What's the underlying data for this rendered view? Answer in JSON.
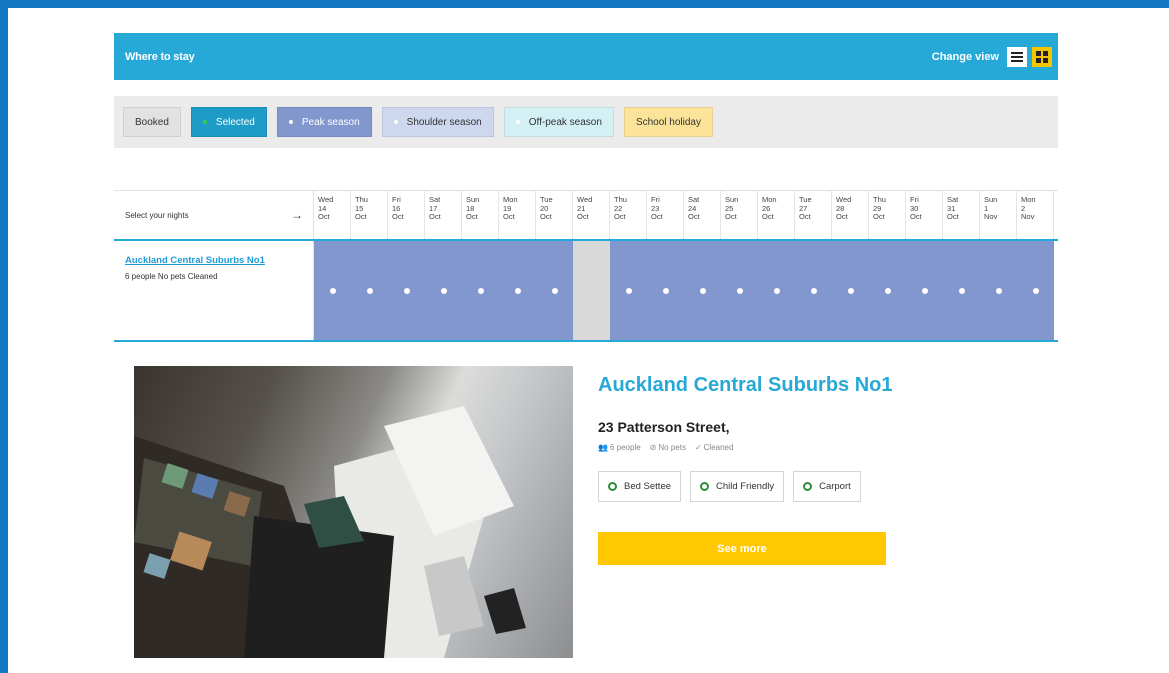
{
  "header": {
    "title": "Where to stay",
    "change_view_label": "Change view",
    "list_view_icon": "list-icon",
    "grid_view_icon": "grid-icon",
    "accent_color": "#27a9d8"
  },
  "legend": [
    {
      "label": "Booked",
      "bg": "#e2e2e2",
      "fg": "#333333",
      "dot": null
    },
    {
      "label": "Selected",
      "bg": "#1e9bc7",
      "fg": "#ffffff",
      "dot": "#2fd14a"
    },
    {
      "label": "Peak season",
      "bg": "#8397cf",
      "fg": "#ffffff",
      "dot": "#ffffff"
    },
    {
      "label": "Shoulder season",
      "bg": "#cdd8ef",
      "fg": "#333333",
      "dot": "#ffffff"
    },
    {
      "label": "Off-peak season",
      "bg": "#d3f0f5",
      "fg": "#333333",
      "dot": "#ffffff"
    },
    {
      "label": "School holiday",
      "bg": "#fce39a",
      "fg": "#333333",
      "dot": null
    }
  ],
  "calendar": {
    "select_label": "Select your nights",
    "days": [
      {
        "dow": "Wed",
        "d": "14",
        "m": "Oct"
      },
      {
        "dow": "Thu",
        "d": "15",
        "m": "Oct"
      },
      {
        "dow": "Fri",
        "d": "16",
        "m": "Oct"
      },
      {
        "dow": "Sat",
        "d": "17",
        "m": "Oct"
      },
      {
        "dow": "Sun",
        "d": "18",
        "m": "Oct"
      },
      {
        "dow": "Mon",
        "d": "19",
        "m": "Oct"
      },
      {
        "dow": "Tue",
        "d": "20",
        "m": "Oct"
      },
      {
        "dow": "Wed",
        "d": "21",
        "m": "Oct"
      },
      {
        "dow": "Thu",
        "d": "22",
        "m": "Oct"
      },
      {
        "dow": "Fri",
        "d": "23",
        "m": "Oct"
      },
      {
        "dow": "Sat",
        "d": "24",
        "m": "Oct"
      },
      {
        "dow": "Sun",
        "d": "25",
        "m": "Oct"
      },
      {
        "dow": "Mon",
        "d": "26",
        "m": "Oct"
      },
      {
        "dow": "Tue",
        "d": "27",
        "m": "Oct"
      },
      {
        "dow": "Wed",
        "d": "28",
        "m": "Oct"
      },
      {
        "dow": "Thu",
        "d": "29",
        "m": "Oct"
      },
      {
        "dow": "Fri",
        "d": "30",
        "m": "Oct"
      },
      {
        "dow": "Sat",
        "d": "31",
        "m": "Oct"
      },
      {
        "dow": "Sun",
        "d": "1",
        "m": "Nov"
      },
      {
        "dow": "Mon",
        "d": "2",
        "m": "Nov"
      }
    ],
    "night_status": [
      "peak",
      "peak",
      "peak",
      "peak",
      "peak",
      "peak",
      "peak",
      "booked",
      "peak",
      "peak",
      "peak",
      "peak",
      "peak",
      "peak",
      "peak",
      "peak",
      "peak",
      "peak",
      "peak",
      "peak"
    ]
  },
  "property": {
    "name_link": "Auckland Central Suburbs No1",
    "summary": "6 people No pets Cleaned"
  },
  "detail": {
    "title": "Auckland Central Suburbs No1",
    "address": "23 Patterson Street,",
    "meta": [
      {
        "icon": "people-icon",
        "text": "6 people"
      },
      {
        "icon": "no-pets-icon",
        "text": "No pets"
      },
      {
        "icon": "cleaned-icon",
        "text": "Cleaned"
      }
    ],
    "amenities": [
      "Bed Settee",
      "Child Friendly",
      "Carport"
    ],
    "see_more_label": "See more"
  }
}
